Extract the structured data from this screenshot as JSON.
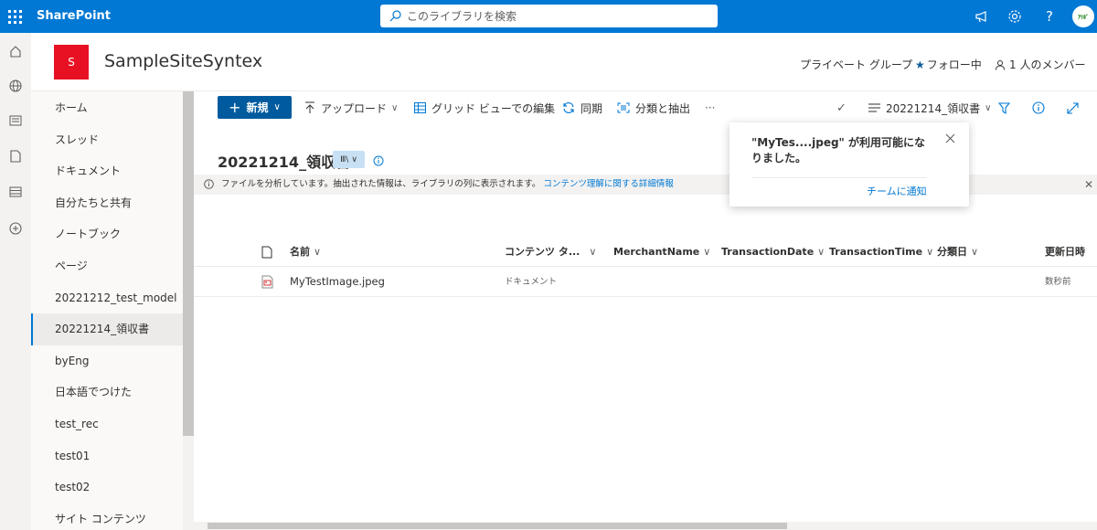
{
  "app": {
    "brand": "SharePoint"
  },
  "search": {
    "placeholder": "このライブラリを検索"
  },
  "avatar": {
    "initials": "ｱﾘﾎﾞ"
  },
  "site": {
    "logo_letter": "S",
    "name": "SampleSiteSyntex",
    "group_type": "プライベート グループ",
    "follow_label": "フォロー中",
    "members_label": "1 人のメンバー"
  },
  "nav": {
    "items": [
      {
        "label": "ホーム"
      },
      {
        "label": "スレッド"
      },
      {
        "label": "ドキュメント"
      },
      {
        "label": "自分たちと共有"
      },
      {
        "label": "ノートブック"
      },
      {
        "label": "ページ"
      },
      {
        "label": "20221212_test_model"
      },
      {
        "label": "20221214_領収書"
      },
      {
        "label": "byEng"
      },
      {
        "label": "日本語でつけた"
      },
      {
        "label": "test_rec"
      },
      {
        "label": "test01"
      },
      {
        "label": "test02"
      },
      {
        "label": "サイト コンテンツ"
      }
    ],
    "active_index": 7
  },
  "commands": {
    "new": "新規",
    "upload": "アップロード",
    "grid_edit": "グリッド ビューでの編集",
    "sync": "同期",
    "classify": "分類と抽出",
    "more": "···",
    "view_name": "20221214_領収書"
  },
  "library": {
    "title": "20221214_領収書",
    "view_chip": "Ⅲ\\"
  },
  "message": {
    "text": "ファイルを分析しています。抽出された情報は、ライブラリの列に表示されます。",
    "link": "コンテンツ理解に関する詳細情報"
  },
  "columns": [
    {
      "label": "名前"
    },
    {
      "label": "コンテンツ タ..."
    },
    {
      "label": "MerchantName"
    },
    {
      "label": "TransactionDate"
    },
    {
      "label": "TransactionTime"
    },
    {
      "label": "分類日"
    },
    {
      "label": "更新日時"
    }
  ],
  "rows": [
    {
      "name": "MyTestImage.jpeg",
      "content_type": "ドキュメント",
      "modified": "数秒前"
    }
  ],
  "toast": {
    "message": "\"MyTes....jpeg\" が利用可能になりました。",
    "action": "チームに通知"
  },
  "colors": {
    "accent": "#0078d4",
    "site_logo": "#e81123"
  }
}
